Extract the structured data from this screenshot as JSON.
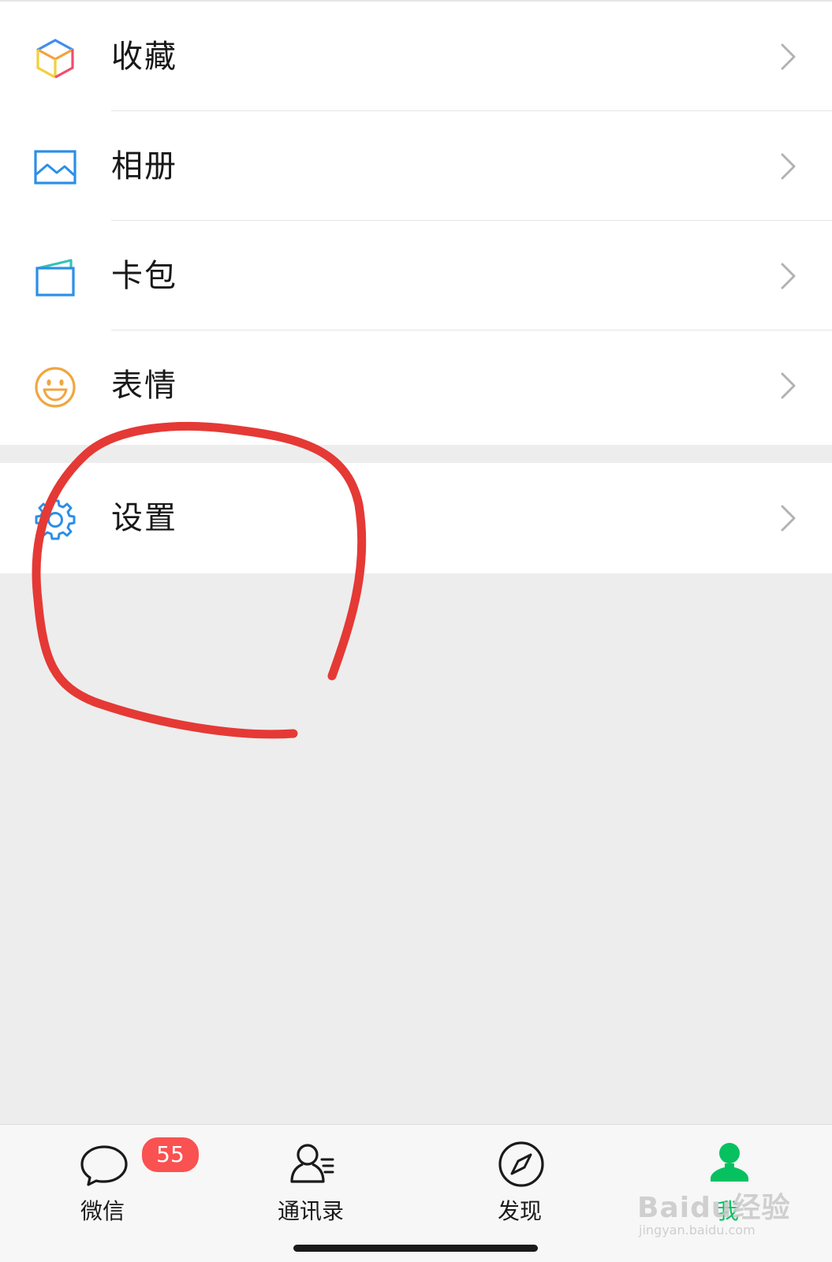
{
  "menu": {
    "items": [
      {
        "label": "收藏",
        "icon": "favorites-cube-icon"
      },
      {
        "label": "相册",
        "icon": "album-image-icon"
      },
      {
        "label": "卡包",
        "icon": "card-wallet-icon"
      },
      {
        "label": "表情",
        "icon": "sticker-smiley-icon"
      }
    ],
    "settings": {
      "label": "设置",
      "icon": "gear-icon"
    }
  },
  "tabbar": {
    "tabs": [
      {
        "label": "微信",
        "icon": "chat-bubble-icon",
        "badge": "55"
      },
      {
        "label": "通讯录",
        "icon": "contacts-icon"
      },
      {
        "label": "发现",
        "icon": "compass-icon"
      },
      {
        "label": "我",
        "icon": "me-person-icon",
        "active": true
      }
    ]
  },
  "watermark": {
    "main": "Baidu经验",
    "sub": "jingyan.baidu.com"
  },
  "colors": {
    "accent": "#07c160",
    "badge": "#fa5151",
    "annotation": "#e53935",
    "background": "#ededed"
  }
}
